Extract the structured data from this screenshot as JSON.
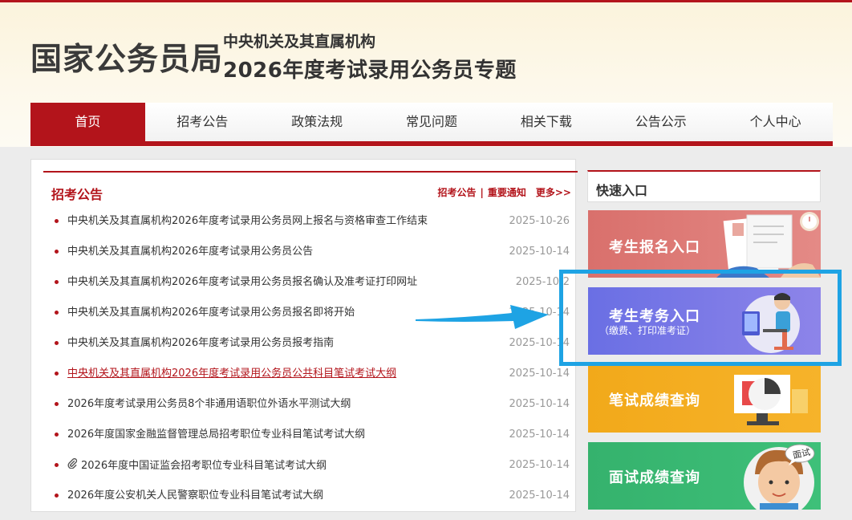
{
  "header": {
    "logo": "国家公务员局",
    "subtitle_line1": "中央机关及其直属机构",
    "subtitle_line2": "2026年度考试录用公务员专题"
  },
  "nav": {
    "items": [
      {
        "label": "首页",
        "active": true
      },
      {
        "label": "招考公告"
      },
      {
        "label": "政策法规"
      },
      {
        "label": "常见问题"
      },
      {
        "label": "相关下载"
      },
      {
        "label": "公告公示"
      },
      {
        "label": "个人中心"
      }
    ]
  },
  "announcements": {
    "title": "招考公告",
    "link1": "招考公告",
    "separator": "|",
    "link2": "重要通知",
    "more": "更多>>",
    "items": [
      {
        "text": "中央机关及其直属机构2026年度考试录用公务员网上报名与资格审查工作结束",
        "date": "2025-10-26"
      },
      {
        "text": "中央机关及其直属机构2026年度考试录用公务员公告",
        "date": "2025-10-14"
      },
      {
        "text": "中央机关及其直属机构2026年度考试录用公务员报名确认及准考证打印网址",
        "date": "2025-10-2"
      },
      {
        "text": "中央机关及其直属机构2026年度考试录用公务员报名即将开始",
        "date": "2025-10-14"
      },
      {
        "text": "中央机关及其直属机构2026年度考试录用公务员报考指南",
        "date": "2025-10-14"
      },
      {
        "text": "中央机关及其直属机构2026年度考试录用公务员公共科目笔试考试大纲",
        "date": "2025-10-14"
      },
      {
        "text": "2026年度考试录用公务员8个非通用语职位外语水平测试大纲",
        "date": "2025-10-14"
      },
      {
        "text": "2026年度国家金融监督管理总局招考职位专业科目笔试考试大纲",
        "date": "2025-10-14"
      },
      {
        "text": "2026年度中国证监会招考职位专业科目笔试考试大纲",
        "date": "2025-10-14"
      },
      {
        "text": "2026年度公安机关人民警察职位专业科目笔试考试大纲",
        "date": "2025-10-14"
      }
    ]
  },
  "quick_entry": {
    "title": "快速入口",
    "cards": [
      {
        "label": "考生报名入口",
        "color": "#d9706c"
      },
      {
        "label": "考生考务入口",
        "sub": "（缴费、打印准考证）",
        "color": "#6a6fe4"
      },
      {
        "label": "笔试成绩查询",
        "color": "#f2a91a"
      },
      {
        "label": "面试成绩查询",
        "color": "#35b26d",
        "badge": "面试"
      }
    ]
  },
  "annotation": {
    "highlight_color": "#1ea3e4",
    "arrow_icon": "arrow-right-icon"
  }
}
